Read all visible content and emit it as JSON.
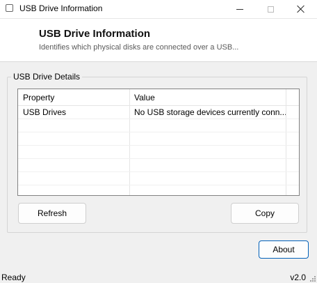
{
  "window": {
    "title": "USB Drive Information",
    "icons": {
      "app": "app-window-icon",
      "minimize": "minimize-icon",
      "maximize": "maximize-icon",
      "close": "close-icon"
    }
  },
  "header": {
    "title": "USB Drive Information",
    "subtitle": "Identifies which physical disks are connected over a USB..."
  },
  "group": {
    "label": "USB Drive Details"
  },
  "list": {
    "columns": [
      "Property",
      "Value"
    ],
    "rows": [
      {
        "property": "USB Drives",
        "value": "No USB storage devices currently conn..."
      }
    ]
  },
  "buttons": {
    "refresh": "Refresh",
    "copy": "Copy",
    "about": "About"
  },
  "status": {
    "text": "Ready",
    "version": "v2.0"
  }
}
